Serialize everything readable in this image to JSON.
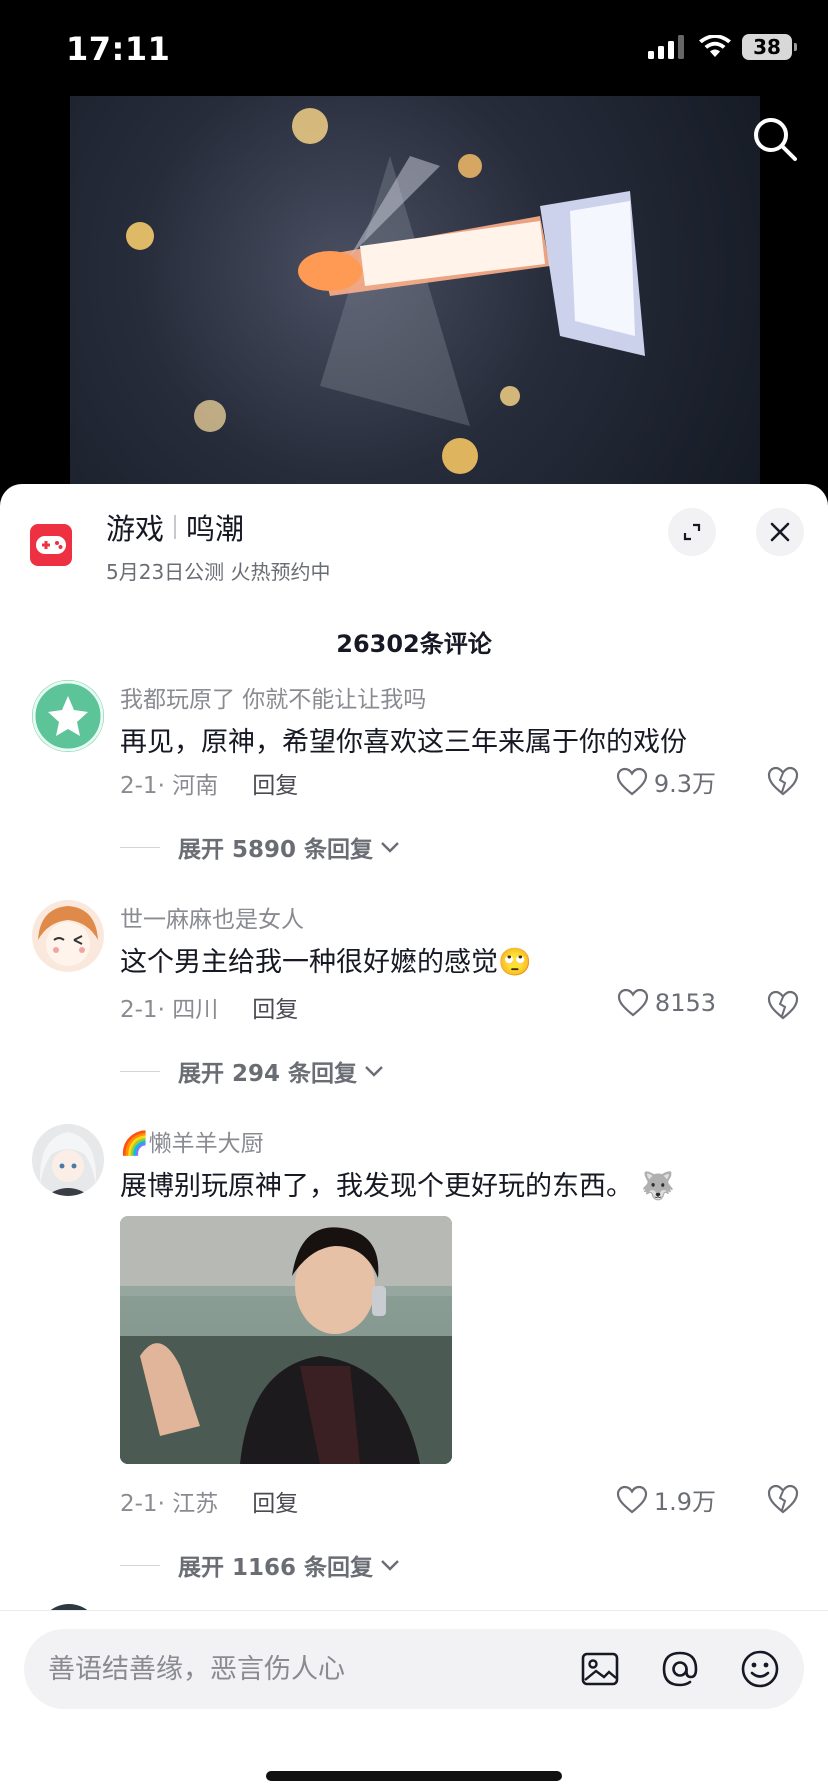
{
  "status_bar": {
    "time": "17:11",
    "battery": "38"
  },
  "game": {
    "category": "游戏",
    "name": "鸣潮",
    "subtitle": "5月23日公测 火热预约中"
  },
  "comments_header": {
    "count_label": "26302条评论"
  },
  "comments": [
    {
      "user": "我都玩原了 你就不能让让我吗",
      "text": "再见，原神，希望你喜欢这三年来属于你的戏份",
      "date_location": "2-1· 河南",
      "reply_label": "回复",
      "likes": "9.3万",
      "expand_label": "展开 5890 条回复"
    },
    {
      "user": "世一麻麻也是女人",
      "text": "这个男主给我一种很好嬷的感觉",
      "emoji": "🙄",
      "date_location": "2-1· 四川",
      "reply_label": "回复",
      "likes": "8153",
      "expand_label": "展开 294 条回复"
    },
    {
      "user_prefix": "🌈",
      "user": "懒羊羊大厨",
      "text": "展博别玩原神了，我发现个更好玩的东西。",
      "emoji": "🐺",
      "date_location": "2-1· 江苏",
      "reply_label": "回复",
      "likes": "1.9万",
      "expand_label": "展开 1166 条回复"
    }
  ],
  "input": {
    "placeholder": "善语结善缘，恶言伤人心"
  },
  "colors": {
    "accent_red": "#ee3142",
    "text_primary": "#161823",
    "text_secondary": "#8a8b91"
  },
  "icons": [
    "search-icon",
    "game-controller-icon",
    "expand-icon",
    "close-icon",
    "heart-icon",
    "dislike-icon",
    "chevron-down-icon",
    "image-icon",
    "at-icon",
    "emoji-icon"
  ]
}
